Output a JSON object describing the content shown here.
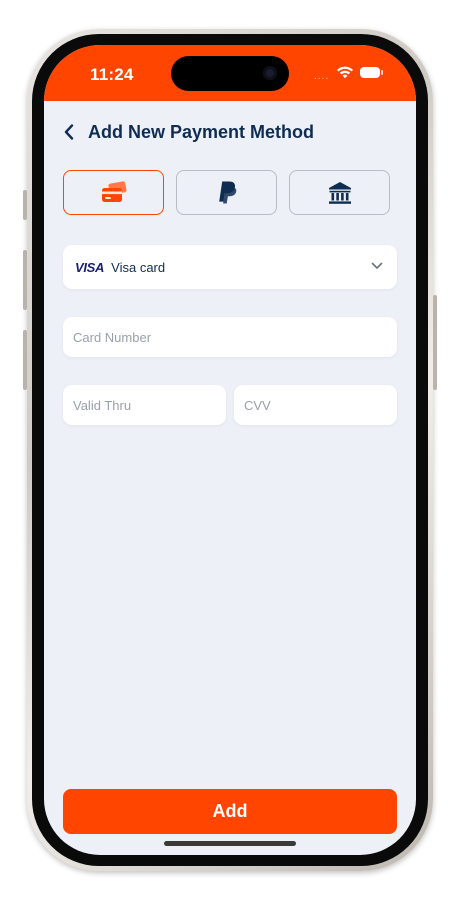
{
  "status_bar": {
    "time": "11:24",
    "signal_dots": "....",
    "accent_color": "#FF4500"
  },
  "header": {
    "title": "Add New Payment Method",
    "back_icon": "chevron-left-icon"
  },
  "payment_methods": [
    {
      "name": "card",
      "icon": "credit-card-icon",
      "selected": true
    },
    {
      "name": "paypal",
      "icon": "paypal-icon",
      "selected": false
    },
    {
      "name": "bank",
      "icon": "bank-icon",
      "selected": false
    }
  ],
  "card_type_select": {
    "logo_text": "VISA",
    "selected_value": "Visa card",
    "icon": "chevron-down-icon"
  },
  "form": {
    "card_number_placeholder": "Card Number",
    "valid_thru_placeholder": "Valid Thru",
    "cvv_placeholder": "CVV"
  },
  "actions": {
    "add_label": "Add"
  },
  "colors": {
    "brand": "#FF4500",
    "title_text": "#0F2D52",
    "background": "#EEF0F8"
  }
}
